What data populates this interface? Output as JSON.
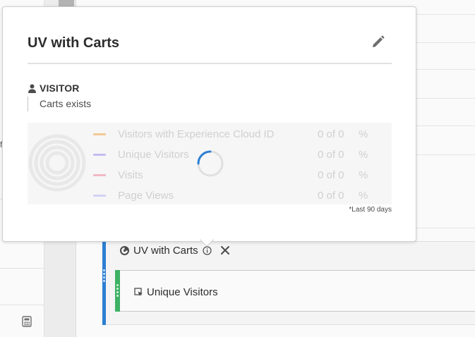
{
  "background": {
    "rail_stub_text": "f",
    "segment": {
      "title": "UV with Carts"
    },
    "metric": {
      "title": "Unique Visitors"
    }
  },
  "popover": {
    "title": "UV with Carts",
    "container": {
      "label": "VISITOR",
      "icon": "person-icon"
    },
    "rule": "Carts exists",
    "stats": [
      {
        "name": "Visitors with Experience Cloud ID",
        "count": "0 of 0",
        "pct": "%",
        "color": "#f2c998"
      },
      {
        "name": "Unique Visitors",
        "count": "0 of 0",
        "pct": "%",
        "color": "#c4bdf0"
      },
      {
        "name": "Visits",
        "count": "0 of 0",
        "pct": "%",
        "color": "#f1b8c4"
      },
      {
        "name": "Page Views",
        "count": "0 of 0",
        "pct": "%",
        "color": "#d2d2f3"
      }
    ],
    "footnote": "*Last 90 days"
  },
  "colors": {
    "segment_accent": "#2d7fd3",
    "metric_accent": "#3db163",
    "spinner": "#2d7fd3"
  }
}
